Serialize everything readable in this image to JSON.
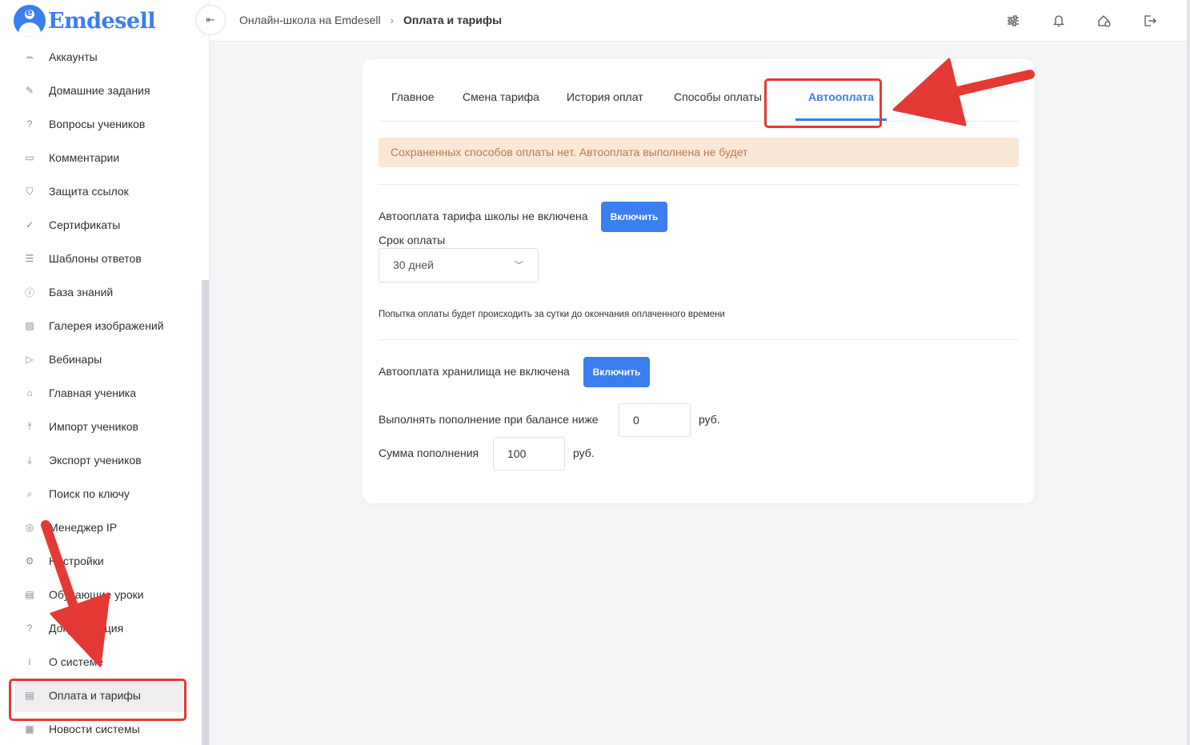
{
  "brand": {
    "name": "Emdesell",
    "badge_letter": "e"
  },
  "sidebar": {
    "items": [
      {
        "label": "Аккаунты",
        "icon": "users-icon",
        "glyph": "ꕀ"
      },
      {
        "label": "Домашние задания",
        "icon": "pencil-icon",
        "glyph": "✎"
      },
      {
        "label": "Вопросы учеников",
        "icon": "question-circle-icon",
        "glyph": "?"
      },
      {
        "label": "Комментарии",
        "icon": "comment-icon",
        "glyph": "▭"
      },
      {
        "label": "Защита ссылок",
        "icon": "shield-icon",
        "glyph": "⛉"
      },
      {
        "label": "Сертификаты",
        "icon": "check-circle-icon",
        "glyph": "✓"
      },
      {
        "label": "Шаблоны ответов",
        "icon": "list-icon",
        "glyph": "☰"
      },
      {
        "label": "База знаний",
        "icon": "info-circle-icon",
        "glyph": "ⓘ"
      },
      {
        "label": "Галерея изображений",
        "icon": "image-icon",
        "glyph": "▨"
      },
      {
        "label": "Вебинары",
        "icon": "play-icon",
        "glyph": "▷"
      },
      {
        "label": "Главная ученика",
        "icon": "home-icon",
        "glyph": "⌂"
      },
      {
        "label": "Импорт учеников",
        "icon": "upload-icon",
        "glyph": "⤒"
      },
      {
        "label": "Экспорт учеников",
        "icon": "download-icon",
        "glyph": "⤓"
      },
      {
        "label": "Поиск по ключу",
        "icon": "search-icon",
        "glyph": "⌕"
      },
      {
        "label": "Менеджер IP",
        "icon": "target-icon",
        "glyph": "◎"
      },
      {
        "label": "Настройки",
        "icon": "gear-icon",
        "glyph": "⚙"
      },
      {
        "label": "Обучающие уроки",
        "icon": "film-icon",
        "glyph": "▤"
      },
      {
        "label": "Документация",
        "icon": "question-square-icon",
        "glyph": "?"
      },
      {
        "label": "О системе",
        "icon": "info-square-icon",
        "glyph": "i"
      },
      {
        "label": "Оплата и тарифы",
        "icon": "document-icon",
        "glyph": "▤"
      },
      {
        "label": "Новости системы",
        "icon": "news-icon",
        "glyph": "▦"
      }
    ],
    "active_index": 19
  },
  "topbar": {
    "breadcrumb_link": "Онлайн-школа на Emdesell",
    "breadcrumb_separator": "›",
    "breadcrumb_current": "Оплата и тарифы",
    "icons": [
      "sliders-icon",
      "bell-icon",
      "home-settings-icon",
      "logout-icon"
    ]
  },
  "tabs": [
    {
      "label": "Главное",
      "active": false
    },
    {
      "label": "Смена тарифа",
      "active": false
    },
    {
      "label": "История оплат",
      "active": false
    },
    {
      "label": "Способы оплаты",
      "active": false
    },
    {
      "label": "Автооплата",
      "active": true
    }
  ],
  "alert": {
    "text": "Сохраненных способов оплаты нет. Автооплата выполнена не будет"
  },
  "tariff_autopay": {
    "status_text": "Автооплата тарифа школы не включена",
    "enable_label": "Включить",
    "period_label": "Срок оплаты",
    "period_value": "30 дней",
    "hint": "Попытка оплаты будет происходить за сутки до окончания оплаченного времени"
  },
  "storage_autopay": {
    "status_text": "Автооплата хранилища не включена",
    "enable_label": "Включить",
    "threshold_label": "Выполнять пополнение при балансе ниже",
    "threshold_value": "0",
    "threshold_unit": "руб.",
    "amount_label": "Сумма пополнения",
    "amount_value": "100",
    "amount_unit": "руб."
  },
  "colors": {
    "accent": "#3a7ef0",
    "alert_bg": "#fbe7d6",
    "alert_text": "#b97c4e",
    "annotation": "#e53935"
  }
}
